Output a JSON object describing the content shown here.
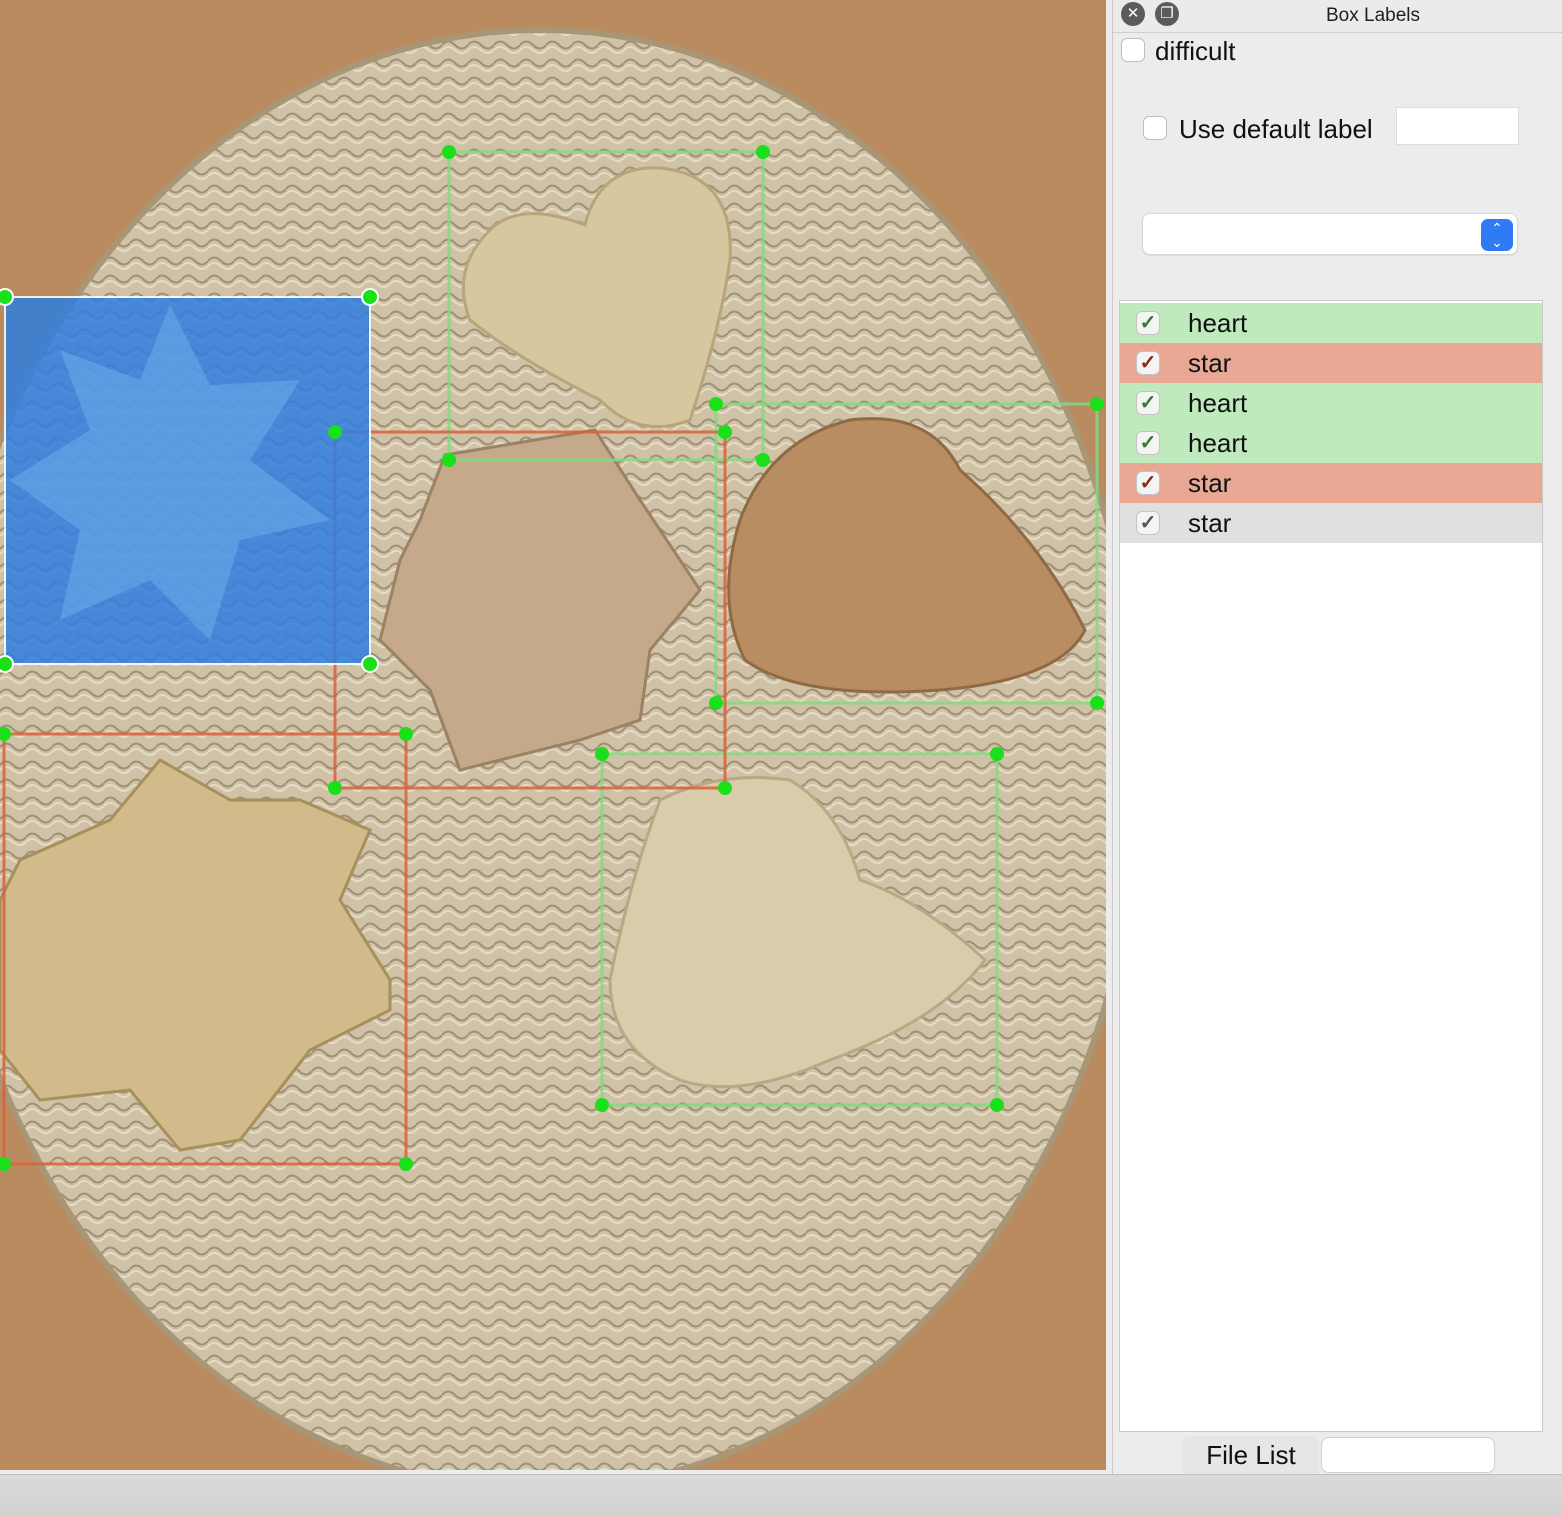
{
  "dock": {
    "title": "Box Labels",
    "close_icon": "close-icon",
    "float_icon": "float-icon",
    "difficult_label": "difficult",
    "use_default_label": "Use default label",
    "default_label_value": "",
    "combo_value": ""
  },
  "labels": [
    {
      "text": "heart",
      "checked": true,
      "color": "#bfeabd"
    },
    {
      "text": "star",
      "checked": true,
      "color": "#e8a894"
    },
    {
      "text": "heart",
      "checked": true,
      "color": "#bfeabd"
    },
    {
      "text": "heart",
      "checked": true,
      "color": "#bfeabd"
    },
    {
      "text": "star",
      "checked": true,
      "color": "#e8a894"
    },
    {
      "text": "star",
      "checked": true,
      "color": "#e0e0e0"
    }
  ],
  "tabs": {
    "file_list": "File List"
  },
  "colors": {
    "heart_box": "#7fdc7f",
    "star_box": "#d9603c",
    "selected_fill": "#2f7fe0",
    "handle": "#19e019"
  }
}
